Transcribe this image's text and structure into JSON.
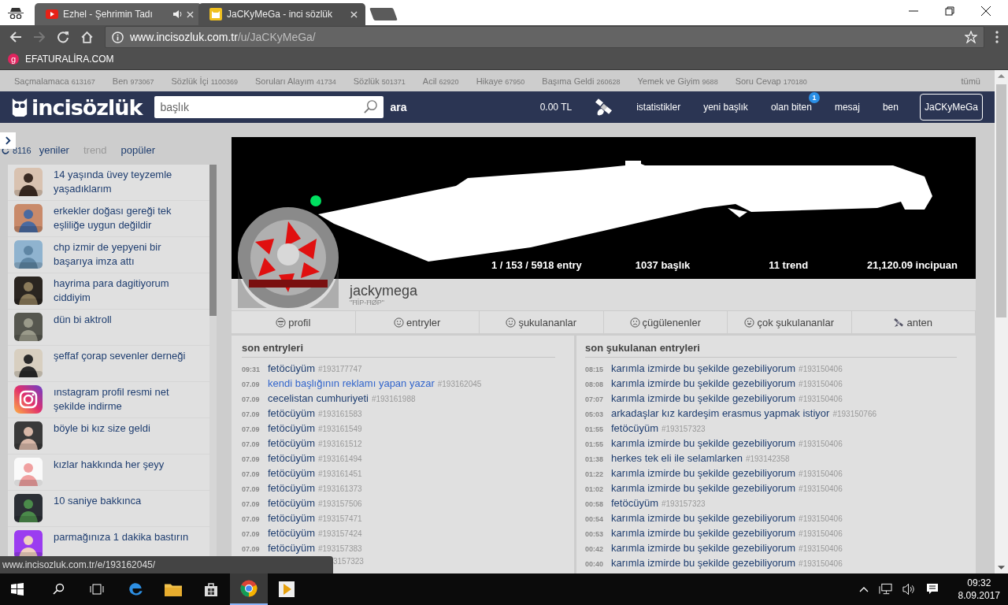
{
  "browser": {
    "tabs": [
      {
        "title": "Ezhel - Şehrimin Tadı",
        "selected": false,
        "kind": "video",
        "audio": true
      },
      {
        "title": "JaCKyMeGa - inci sözlük",
        "selected": true,
        "kind": "site",
        "audio": false
      }
    ],
    "url": {
      "host": "www.incisozluk.com.tr",
      "path": "/u/JaCKyMeGa/"
    },
    "bookmarks": [
      {
        "label": "EFATURALİRA.COM",
        "icon": "g"
      }
    ]
  },
  "categories": [
    {
      "name": "Saçmalamaca",
      "count": "613167"
    },
    {
      "name": "Ben",
      "count": "973067"
    },
    {
      "name": "Sözlük İçi",
      "count": "1100369"
    },
    {
      "name": "Soruları Alayım",
      "count": "41734"
    },
    {
      "name": "Sözlük",
      "count": "501371"
    },
    {
      "name": "Acil",
      "count": "62920"
    },
    {
      "name": "Hikaye",
      "count": "67950"
    },
    {
      "name": "Başıma Geldi",
      "count": "260628"
    },
    {
      "name": "Yemek ve Giyim",
      "count": "9688"
    },
    {
      "name": "Soru Cevap",
      "count": "170180"
    }
  ],
  "categories_all": "tümü",
  "header": {
    "logo": "incisözlük",
    "search": {
      "placeholder": "başlık"
    },
    "search_button": "ara",
    "balance": "0.00 TL",
    "nav": [
      {
        "label": "istatistikler"
      },
      {
        "label": "yeni başlık"
      },
      {
        "label": "olan biten",
        "badge": "1"
      },
      {
        "label": "mesaj"
      },
      {
        "label": "ben"
      }
    ],
    "user": "JaCKyMeGa"
  },
  "sidebar": {
    "count": "8116",
    "tabs": [
      {
        "label": "yeniler",
        "disabled": false
      },
      {
        "label": "trend",
        "disabled": true
      },
      {
        "label": "popüler",
        "disabled": false
      }
    ],
    "topics": [
      {
        "title": "14 yaşında üvey teyzemle yaşadıklarım"
      },
      {
        "title": "erkekler doğası gereği tek eşliliğe uygun değildir"
      },
      {
        "title": "chp izmir de yepyeni bir başarıya imza attı"
      },
      {
        "title": "hayrima para dagitiyorum ciddiyim"
      },
      {
        "title": "dün bi aktroll"
      },
      {
        "title": "şeffaf çorap sevenler derneği"
      },
      {
        "title": "ınstagram profil resmi net şekilde indirme",
        "kind": "logo"
      },
      {
        "title": "böyle bi kız size geldi"
      },
      {
        "title": "kızlar hakkında her şeyy"
      },
      {
        "title": "10 saniye bakkınca"
      },
      {
        "title": "parmağınıza 1 dakika bastırın"
      }
    ]
  },
  "profile": {
    "online": true,
    "stats": [
      "1 / 153 / 5918 entry",
      "1037 başlık",
      "11 trend",
      "21,120.09 incipuan"
    ],
    "username": "jackymega",
    "motto": "\"ĦİP-ĦØP\"",
    "tabs": [
      {
        "label": "profil"
      },
      {
        "label": "entryler"
      },
      {
        "label": "şukulananlar"
      },
      {
        "label": "çügülenenler"
      },
      {
        "label": "çok şukulananlar"
      },
      {
        "label": "anten"
      }
    ]
  },
  "recent": {
    "title": "son entryleri",
    "entries": [
      {
        "time": "09:31",
        "title": "fetöcüyüm",
        "ref": "#193177747",
        "hovered": false,
        "kind": "full"
      },
      {
        "time": "07.09",
        "title": "kendi başlığının reklamı yapan yazar",
        "ref": "#193162045",
        "hovered": true,
        "kind": "full"
      },
      {
        "time": "07.09",
        "title": "cecelistan cumhuriyeti",
        "ref": "#193161988",
        "hovered": false,
        "kind": "full"
      },
      {
        "time": "07.09",
        "title": "fetöcüyüm",
        "ref": "#193161583",
        "hovered": false,
        "kind": "full"
      },
      {
        "time": "07.09",
        "title": "fetöcüyüm",
        "ref": "#193161549",
        "hovered": false,
        "kind": "full"
      },
      {
        "time": "07.09",
        "title": "fetöcüyüm",
        "ref": "#193161512",
        "hovered": false,
        "kind": "full"
      },
      {
        "time": "07.09",
        "title": "fetöcüyüm",
        "ref": "#193161494",
        "hovered": false,
        "kind": "full"
      },
      {
        "time": "07.09",
        "title": "fetöcüyüm",
        "ref": "#193161451",
        "hovered": false,
        "kind": "full"
      },
      {
        "time": "07.09",
        "title": "fetöcüyüm",
        "ref": "#193161373",
        "hovered": false,
        "kind": "full"
      },
      {
        "time": "07.09",
        "title": "fetöcüyüm",
        "ref": "#193157506",
        "hovered": false,
        "kind": "full"
      },
      {
        "time": "07.09",
        "title": "fetöcüyüm",
        "ref": "#193157471",
        "hovered": false,
        "kind": "full"
      },
      {
        "time": "07.09",
        "title": "fetöcüyüm",
        "ref": "#193157424",
        "hovered": false,
        "kind": "full"
      },
      {
        "time": "07.09",
        "title": "fetöcüyüm",
        "ref": "#193157383",
        "hovered": false,
        "kind": "full"
      },
      {
        "ref": "3157323",
        "kind": "partial"
      }
    ]
  },
  "liked": {
    "title": "son şukulanan entryleri",
    "entries": [
      {
        "time": "08:15",
        "title": "karımla izmirde bu şekilde gezebiliyorum",
        "ref": "#193150406",
        "hovered": false,
        "kind": "full"
      },
      {
        "time": "08:08",
        "title": "karımla izmirde bu şekilde gezebiliyorum",
        "ref": "#193150406",
        "hovered": false,
        "kind": "full"
      },
      {
        "time": "07:07",
        "title": "karımla izmirde bu şekilde gezebiliyorum",
        "ref": "#193150406",
        "hovered": false,
        "kind": "full"
      },
      {
        "time": "05:03",
        "title": "arkadaşlar kız kardeşim erasmus yapmak istiyor",
        "ref": "#193150766",
        "hovered": false,
        "kind": "full"
      },
      {
        "time": "01:55",
        "title": "fetöcüyüm",
        "ref": "#193157323",
        "hovered": false,
        "kind": "full"
      },
      {
        "time": "01:55",
        "title": "karımla izmirde bu şekilde gezebiliyorum",
        "ref": "#193150406",
        "hovered": false,
        "kind": "full"
      },
      {
        "time": "01:38",
        "title": "herkes tek eli ile selamlarken",
        "ref": "#193142358",
        "hovered": false,
        "kind": "full"
      },
      {
        "time": "01:22",
        "title": "karımla izmirde bu şekilde gezebiliyorum",
        "ref": "#193150406",
        "hovered": false,
        "kind": "full"
      },
      {
        "time": "01:02",
        "title": "karımla izmirde bu şekilde gezebiliyorum",
        "ref": "#193150406",
        "hovered": false,
        "kind": "full"
      },
      {
        "time": "00:58",
        "title": "fetöcüyüm",
        "ref": "#193157323",
        "hovered": false,
        "kind": "full"
      },
      {
        "time": "00:54",
        "title": "karımla izmirde bu şekilde gezebiliyorum",
        "ref": "#193150406",
        "hovered": false,
        "kind": "full"
      },
      {
        "time": "00:53",
        "title": "karımla izmirde bu şekilde gezebiliyorum",
        "ref": "#193150406",
        "hovered": false,
        "kind": "full"
      },
      {
        "time": "00:42",
        "title": "karımla izmirde bu şekilde gezebiliyorum",
        "ref": "#193150406",
        "hovered": false,
        "kind": "full"
      },
      {
        "time": "00:40",
        "title": "karımla izmirde bu şekilde gezebiliyorum",
        "ref": "#193150406",
        "hovered": false,
        "kind": "full"
      }
    ]
  },
  "status_url": "www.incisozluk.com.tr/e/193162045/",
  "taskbar": {
    "apps": [
      {
        "kind": "edge",
        "active": false
      },
      {
        "kind": "folder",
        "active": false
      },
      {
        "kind": "store",
        "active": false
      },
      {
        "kind": "chrome",
        "active": true
      },
      {
        "kind": "player",
        "active": false
      }
    ],
    "time": "09:32",
    "date": "8.09.2017"
  }
}
